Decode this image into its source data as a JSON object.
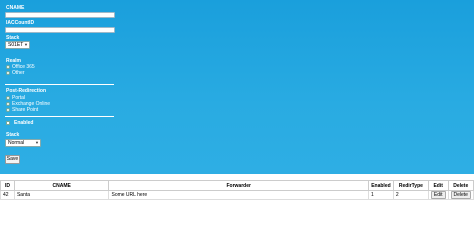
{
  "form": {
    "cname_label": "CNAME",
    "cname_value": "",
    "iaccountid_label": "IACCountID",
    "iaccountid_value": "",
    "stack_label": "Stack",
    "stack_value": "S01ET",
    "realm_label": "Realm",
    "realm_options": [
      "Office 365",
      "Other"
    ],
    "post_redirection_label": "Post-Redirection",
    "post_redirection_options": [
      "Portal",
      "Exchange Online",
      "Share Point"
    ],
    "enabled_label": "Enabled",
    "stack2_label": "Stack",
    "stack2_value": "Normal",
    "save_label": "Save"
  },
  "table": {
    "headers": [
      "ID",
      "CNAME",
      "Forwarder",
      "Enabled",
      "RedirType",
      "Edit",
      "Delete"
    ],
    "rows": [
      {
        "id": "42",
        "cname": "Santa",
        "forwarder": "Some URL here",
        "enabled": "1",
        "redirtype": "2",
        "edit": "Edit",
        "delete": "Delete"
      }
    ]
  },
  "colors": {
    "panel_bg": "#29abe2"
  }
}
